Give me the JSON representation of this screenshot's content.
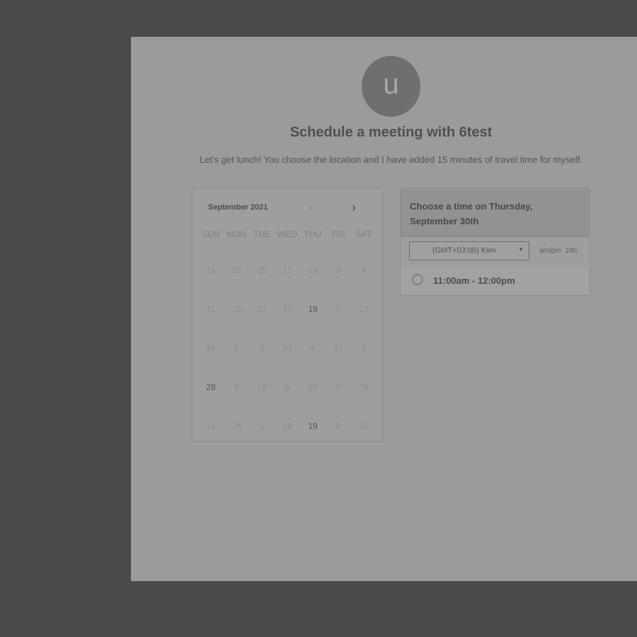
{
  "header": {
    "avatar_letter": "u",
    "title": "Schedule a meeting with 6test",
    "subtitle": "Let's get lunch! You choose the location and I have added 15 minutes of travel time for myself."
  },
  "calendar": {
    "month_label": "September 2021",
    "prev_icon": "chevron-left-icon",
    "next_icon": "chevron-right-icon",
    "weekdays": [
      "SUN",
      "MON",
      "TUE",
      "WED",
      "THU",
      "FRI",
      "SAT"
    ],
    "weeks": [
      [
        "15",
        "30",
        "15",
        "11",
        "14",
        "3",
        "4"
      ],
      [
        "31",
        "18",
        "27",
        "13",
        "19",
        "2",
        "17"
      ],
      [
        "10",
        "6",
        "2",
        "31",
        "4",
        "17",
        "2"
      ],
      [
        "28",
        "6",
        "16",
        "6",
        "20",
        "8",
        "29"
      ],
      [
        "11",
        "24",
        "1",
        "16",
        "19",
        "9",
        "16"
      ]
    ]
  },
  "time_panel": {
    "heading": "Choose a time on Thursday, September 30th",
    "timezone": "(GMT+03:00) Kiev",
    "format_ampm": "am/pm",
    "format_24h": "24h",
    "slots": [
      "11:00am - 12:00pm"
    ]
  },
  "colors": {
    "backdrop": "#4a4a4a",
    "card": "#9b9b9b",
    "avatar": "#6f6f6f"
  }
}
